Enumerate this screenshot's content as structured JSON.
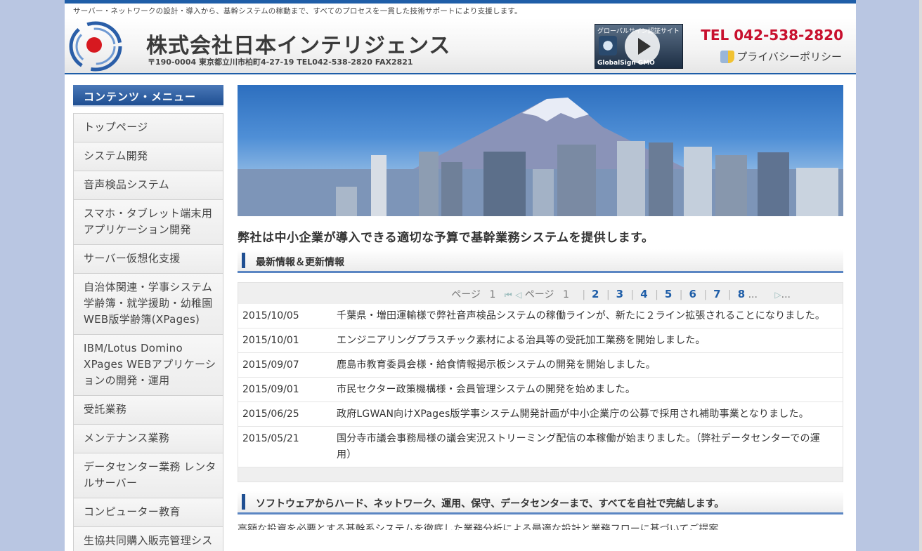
{
  "header": {
    "tagline": "サーバー・ネットワークの設計・導入から、基幹システムの稼動まで、すべてのプロセスを一貫した技術サポートにより支援します。",
    "company_name": "株式会社日本インテリジェンス",
    "address": "〒190-0004 東京都立川市柏町4-27-19 TEL042-538-2820 FAX2821",
    "tel": "TEL 042-538-2820",
    "privacy_link": "プライバシーポリシー",
    "badge_top": "グローバルサイン認証サイト",
    "badge_bottom": "GlobalSign GMO"
  },
  "sidebar": {
    "heading": "コンテンツ・メニュー",
    "items": [
      {
        "label": "トップページ"
      },
      {
        "label": "システム開発"
      },
      {
        "label": "音声検品システム"
      },
      {
        "label": "スマホ・タブレット端末用アプリケーション開発"
      },
      {
        "label": "サーバー仮想化支援"
      },
      {
        "label": "自治体関連・学事システム学齢簿・就学援助・幼稚園WEB版学齢簿(XPages)"
      },
      {
        "label": "IBM/Lotus Domino XPages WEBアプリケーションの開発・運用"
      },
      {
        "label": "受託業務"
      },
      {
        "label": "メンテナンス業務"
      },
      {
        "label": "データセンター業務 レンタルサーバー"
      },
      {
        "label": "コンピューター教育"
      },
      {
        "label": "生協共同購入販売管理システム・ソリューション"
      }
    ]
  },
  "main": {
    "lead": "弊社は中小企業が導入できる適切な予算で基幹業務システムを提供します。",
    "news_heading": "最新情報＆更新情報",
    "pager": {
      "page_label": "ページ",
      "current": "1",
      "pages": [
        "2",
        "3",
        "4",
        "5",
        "6",
        "7",
        "8"
      ],
      "ellipsis": "...",
      "next_ellipsis": "..."
    },
    "news": [
      {
        "date": "2015/10/05",
        "text": "千葉県・増田運輸様で弊社音声検品システムの稼働ラインが、新たに２ライン拡張されることになりました。"
      },
      {
        "date": "2015/10/01",
        "text": "エンジニアリングプラスチック素材による治具等の受託加工業務を開始しました。"
      },
      {
        "date": "2015/09/07",
        "text": "鹿島市教育委員会様・給食情報掲示板システムの開発を開始しました。"
      },
      {
        "date": "2015/09/01",
        "text": "市民セクター政策機構様・会員管理システムの開発を始めました。"
      },
      {
        "date": "2015/06/25",
        "text": "政府LGWAN向けXPages版学事システム開発計画が中小企業庁の公募で採用され補助事業となりました。"
      },
      {
        "date": "2015/05/21",
        "text": "国分寺市議会事務局様の議会実況ストリーミング配信の本稼働が始まりました。（弊社データセンターでの運用）"
      }
    ],
    "section2_heading": "ソフトウェアからハード、ネットワーク、運用、保守、データセンターまで、すべてを自社で完結します。",
    "section2_text": "高額な投資を必要とする基幹系システムを徹底した業務分析による最適な設計と業務フローに基づいてご提案"
  }
}
